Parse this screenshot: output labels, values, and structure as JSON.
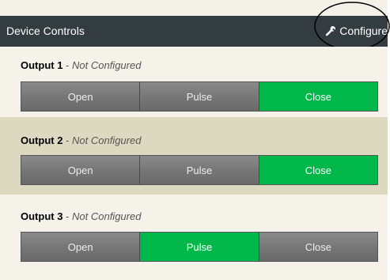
{
  "header": {
    "title": "Device Controls",
    "configure_label": "Configure"
  },
  "outputs": [
    {
      "name": "Output 1",
      "separator": " - ",
      "status": "Not Configured",
      "buttons": [
        "Open",
        "Pulse",
        "Close"
      ],
      "active": "Close"
    },
    {
      "name": "Output 2",
      "separator": " - ",
      "status": "Not Configured",
      "buttons": [
        "Open",
        "Pulse",
        "Close"
      ],
      "active": "Close"
    },
    {
      "name": "Output 3",
      "separator": " - ",
      "status": "Not Configured",
      "buttons": [
        "Open",
        "Pulse",
        "Close"
      ],
      "active": "Pulse"
    }
  ],
  "colors": {
    "header_bg": "#333c40",
    "active_button": "#00b84a",
    "inactive_button": "#777777",
    "row_light": "#f4f2e9",
    "row_dark": "#ddd9c1"
  },
  "icons": {
    "configure": "wrench-icon"
  }
}
